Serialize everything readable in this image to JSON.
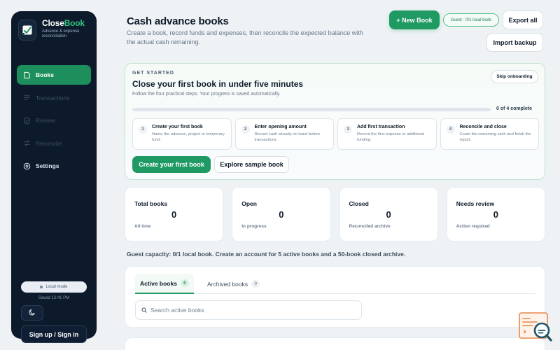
{
  "brand": {
    "name_prefix": "Close",
    "name_accent": "Book",
    "tagline": "Advance & expense reconciliation",
    "logo_icon": "check-chart-icon"
  },
  "sidebar": {
    "items": [
      {
        "label": "Books",
        "icon": "book-icon",
        "state": "active"
      },
      {
        "label": "Transactions",
        "icon": "transactions-icon",
        "state": "disabled"
      },
      {
        "label": "Review",
        "icon": "check-circle-icon",
        "state": "disabled"
      },
      {
        "label": "Reconcile",
        "icon": "swap-icon",
        "state": "disabled"
      },
      {
        "label": "Settings",
        "icon": "gear-icon",
        "state": "normal"
      }
    ],
    "local_mode": "Local mode",
    "saved": "Saved 12:41 PM",
    "theme_icon": "moon-icon",
    "signin": "Sign up / Sign in"
  },
  "header": {
    "title": "Cash advance books",
    "subtitle": "Create a book, record funds and expenses, then reconcile the expected balance with the actual cash remaining.",
    "new_book": "+ New Book",
    "guest_badge": "Guest · 0/1 local book",
    "export_all": "Export all",
    "import_backup": "Import backup"
  },
  "get_started": {
    "eyebrow": "GET STARTED",
    "title": "Close your first book in under five minutes",
    "subtitle": "Follow the four practical steps. Your progress is saved automatically.",
    "skip": "Skip onboarding",
    "progress_fraction": 0,
    "progress_text": "0 of 4 complete",
    "steps": [
      {
        "num": "1",
        "title": "Create your first book",
        "desc": "Name the advance, project or temporary fund."
      },
      {
        "num": "2",
        "title": "Enter opening amount",
        "desc": "Record cash already on hand before transactions."
      },
      {
        "num": "3",
        "title": "Add first transaction",
        "desc": "Record the first expense or additional funding."
      },
      {
        "num": "4",
        "title": "Reconcile and close",
        "desc": "Count the remaining cash and finish the report."
      }
    ],
    "primary_cta": "Create your first book",
    "secondary_cta": "Explore sample book"
  },
  "stats": [
    {
      "label": "Total books",
      "value": "0",
      "foot": "All time"
    },
    {
      "label": "Open",
      "value": "0",
      "foot": "In progress"
    },
    {
      "label": "Closed",
      "value": "0",
      "foot": "Reconciled archive"
    },
    {
      "label": "Needs review",
      "value": "0",
      "foot": "Action required"
    }
  ],
  "capacity_text": "Guest capacity: 0/1 local book. Create an account for 5 active books and a 50-book closed archive.",
  "books": {
    "tabs": [
      {
        "label": "Active books",
        "count": "0"
      },
      {
        "label": "Archived books",
        "count": "0"
      }
    ],
    "search_placeholder": "Search active books",
    "search_icon": "search-icon"
  },
  "help_widget_icon": "help-search-icon",
  "colors": {
    "accent": "#1f9a63",
    "sidebar_bg": "#0d1a2b",
    "page_bg": "#eef2f5"
  }
}
